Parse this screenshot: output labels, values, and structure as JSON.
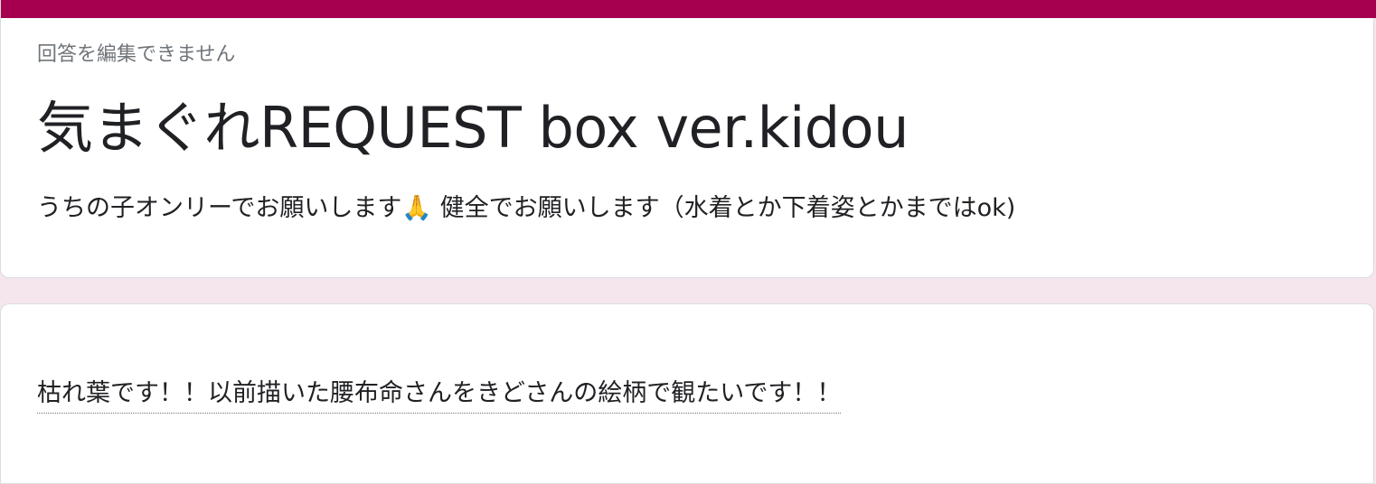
{
  "theme": {
    "accent": "#a50050",
    "page_background": "#f5e6ee",
    "card_background": "#ffffff"
  },
  "header": {
    "notice": "回答を編集できません",
    "title": "気まぐれREQUEST box ver.kidou",
    "description": "うちの子オンリーでお願いします🙏 健全でお願いします（水着とか下着姿とかまではok)"
  },
  "response": {
    "answer": "枯れ葉です！！以前描いた腰布命さんをきどさんの絵柄で観たいです！！"
  }
}
